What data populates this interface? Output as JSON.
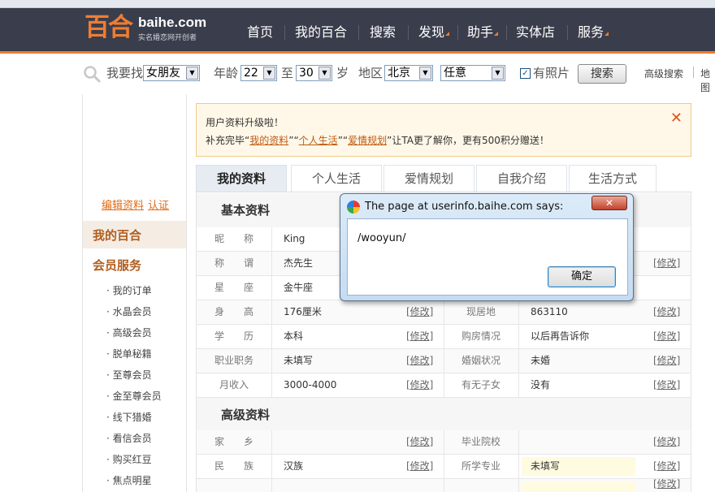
{
  "header": {
    "logo_text": "百合",
    "logo_domain": "baihe.com",
    "logo_tagline": "实名婚恋网开创者",
    "nav": [
      {
        "label": "首页",
        "has_arrow": false
      },
      {
        "label": "我的百合",
        "has_arrow": false
      },
      {
        "label": "搜索",
        "has_arrow": false
      },
      {
        "label": "发现",
        "has_arrow": true
      },
      {
        "label": "助手",
        "has_arrow": true
      },
      {
        "label": "实体店",
        "has_arrow": false
      },
      {
        "label": "服务",
        "has_arrow": true
      }
    ]
  },
  "search": {
    "looking_for_label": "我要找",
    "looking_for_value": "女朋友",
    "age_label": "年龄",
    "age_from": "22",
    "age_to_label": "至",
    "age_to": "30",
    "age_unit": "岁",
    "region_label": "地区",
    "region_value": "北京",
    "region_sub_value": "任意",
    "with_photo_label": "有照片",
    "with_photo_checked": true,
    "search_button": "搜索",
    "advanced_search": "高级搜索",
    "map_link": "地图"
  },
  "sidebar": {
    "edit_profile": "编辑资料",
    "verify": "认证",
    "my_baihe": "我的百合",
    "member_services": "会员服务",
    "items": [
      "我的订单",
      "水晶会员",
      "高级会员",
      "脱单秘籍",
      "至尊会员",
      "金至尊会员",
      "线下猎婚",
      "看信会员",
      "购买红豆",
      "焦点明星"
    ]
  },
  "banner": {
    "line1": "用户资料升级啦！",
    "line2_prefix": "补充完毕“",
    "link1": "我的资料",
    "sep1": "”“",
    "link2": "个人生活",
    "sep2": "”“",
    "link3": "爱情规划",
    "line2_suffix": "”让TA更了解你，更有500积分赠送！"
  },
  "tabs": [
    "我的资料",
    "个人生活",
    "爱情规划",
    "自我介绍",
    "生活方式"
  ],
  "profile": {
    "basic_title": "基本资料",
    "basic_rows": [
      {
        "k1": "昵　　称",
        "v1": "King"
      },
      {
        "k1": "称　　谓",
        "v1": "杰先生",
        "e2": "[修改]"
      },
      {
        "k1": "星　　座",
        "v1": "金牛座"
      },
      {
        "k1": "身　　高",
        "v1": "176厘米",
        "e1": "[修改]",
        "k2": "现居地",
        "v2": "863110",
        "e2": "[修改]"
      },
      {
        "k1": "学　　历",
        "v1": "本科",
        "e1": "[修改]",
        "k2": "购房情况",
        "v2": "以后再告诉你",
        "e2": "[修改]"
      },
      {
        "k1": "职业职务",
        "v1": "未填写",
        "e1": "[修改]",
        "k2": "婚姻状况",
        "v2": "未婚",
        "e2": "[修改]"
      },
      {
        "k1": "月收入",
        "v1": "3000-4000",
        "e1": "[修改]",
        "k2": "有无子女",
        "v2": "没有",
        "e2": "[修改]"
      }
    ],
    "advanced_title": "高级资料",
    "advanced_rows": [
      {
        "k1": "家　　乡",
        "v1": "",
        "e1": "[修改]",
        "k2": "毕业院校",
        "v2": "",
        "e2": "[修改]"
      },
      {
        "k1": "民　　族",
        "v1": "汉族",
        "e1": "[修改]",
        "k2": "所学专业",
        "v2": "未填写",
        "e2": "[修改]"
      },
      {
        "k1": "",
        "v1": "",
        "e1": "",
        "k2": "",
        "v2": "",
        "e2": "[修改]"
      }
    ]
  },
  "dialog": {
    "title": "The page at userinfo.baihe.com says:",
    "message": "/wooyun/",
    "ok_button": "确定",
    "close_glyph": "✕"
  },
  "colors": {
    "nav_bg": "#3a3d4b",
    "brand_orange": "#ef7d31",
    "link_orange": "#e06a15"
  }
}
